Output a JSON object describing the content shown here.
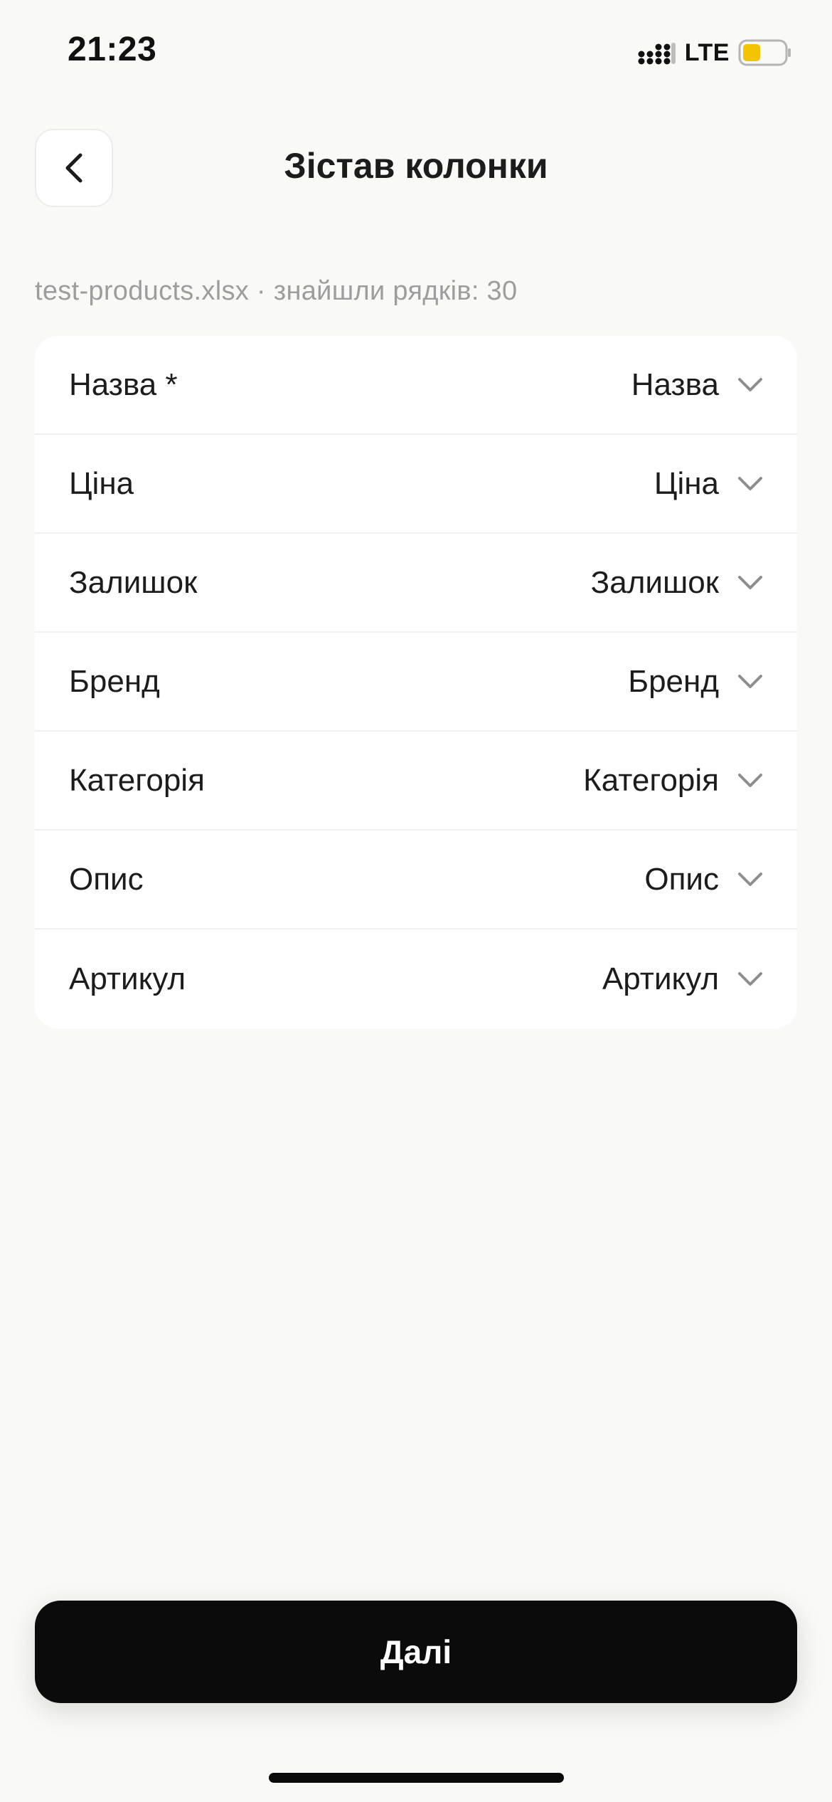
{
  "status_bar": {
    "time": "21:23",
    "network": "LTE",
    "battery_color": "#f5c400"
  },
  "header": {
    "title": "Зістав колонки",
    "back_icon": "chevron-left-icon"
  },
  "file_info": "test-products.xlsx · знайшли рядків: 30",
  "mappings": [
    {
      "label": "Назва *",
      "value": "Назва"
    },
    {
      "label": "Ціна",
      "value": "Ціна"
    },
    {
      "label": "Залишок",
      "value": "Залишок"
    },
    {
      "label": "Бренд",
      "value": "Бренд"
    },
    {
      "label": "Категорія",
      "value": "Категорія"
    },
    {
      "label": "Опис",
      "value": "Опис"
    },
    {
      "label": "Артикул",
      "value": "Артикул"
    }
  ],
  "footer": {
    "next_label": "Далі"
  }
}
